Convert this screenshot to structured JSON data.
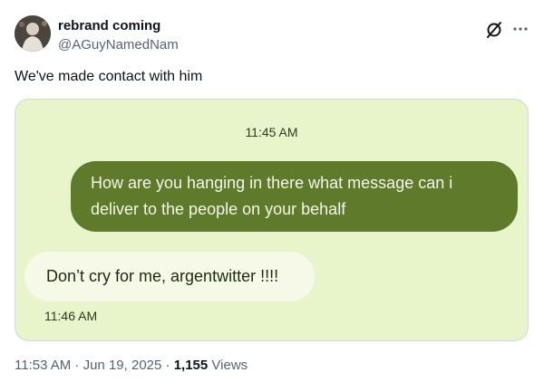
{
  "author": {
    "display_name": "rebrand coming",
    "handle": "@AGuyNamedNam"
  },
  "tweet": {
    "text": "We've made contact with him"
  },
  "screenshot": {
    "time_top": "11:45 AM",
    "outgoing_message": "How are you hanging in there what message can i deliver to the people on your behalf",
    "incoming_message": "Don’t cry for me, argentwitter !!!!",
    "time_bottom": "11:46 AM"
  },
  "meta": {
    "time": "11:53 AM",
    "separator_1": " · ",
    "date": "Jun 19, 2025",
    "separator_2": " · ",
    "views_count": "1,155",
    "views_label": " Views"
  },
  "icons": {
    "grok": "grok-icon",
    "more": "more-icon"
  },
  "colors": {
    "outgoing_bubble": "#5e7a2a",
    "incoming_bubble": "#f7f9e8",
    "chat_background": "#e8f4c9",
    "secondary_text": "#536471"
  }
}
